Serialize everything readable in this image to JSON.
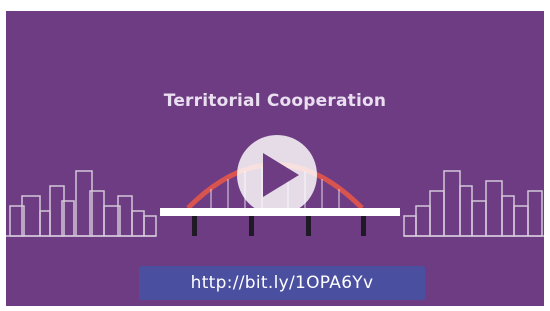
{
  "video": {
    "title": "Territorial Cooperation",
    "link": "http://bit.ly/1OPA6Yv"
  },
  "icons": [
    "play-icon"
  ],
  "colors": {
    "background": "#6e3c82",
    "link_box": "#4a4fa0",
    "bridge_arch": "#d9534f",
    "skyline": "#e6e0ea"
  }
}
